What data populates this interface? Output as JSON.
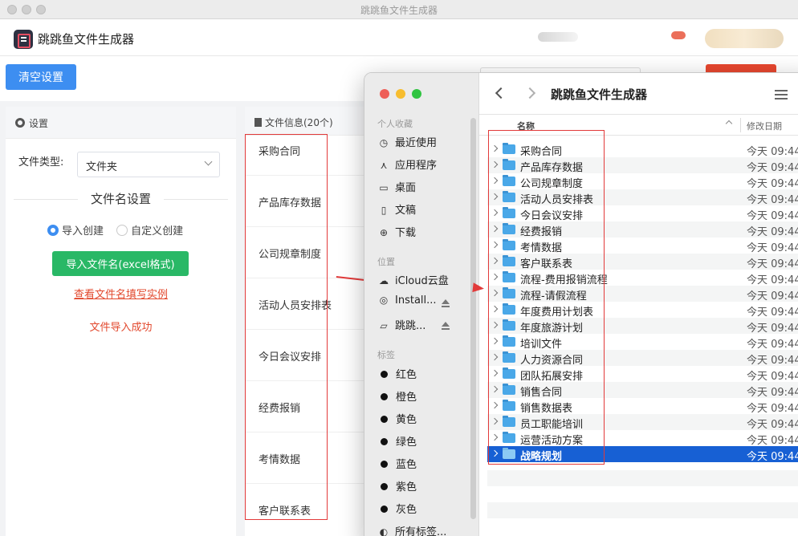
{
  "window": {
    "title": "跳跳鱼文件生成器"
  },
  "header": {
    "app_name": "跳跳鱼文件生成器"
  },
  "toolbar": {
    "clear_label": "清空设置"
  },
  "settings": {
    "title": "设置",
    "file_type_label": "文件类型:",
    "file_type_value": "文件夹",
    "section_title": "文件名设置",
    "radio_import": "导入创建",
    "radio_custom": "自定义创建",
    "import_button": "导入文件名(excel格式)",
    "example_link": "查看文件名填写实例",
    "import_status": "文件导入成功"
  },
  "file_info": {
    "title": "文件信息(20个)",
    "items": [
      "采购合同",
      "产品库存数据",
      "公司规章制度",
      "活动人员安排表",
      "今日会议安排",
      "经费报销",
      "考情数据",
      "客户联系表"
    ]
  },
  "finder": {
    "title": "跳跳鱼文件生成器",
    "sidebar": {
      "favorites_label": "个人收藏",
      "favorites": [
        {
          "label": "最近使用",
          "icon": "clock-icon"
        },
        {
          "label": "应用程序",
          "icon": "apps-icon"
        },
        {
          "label": "桌面",
          "icon": "desktop-icon"
        },
        {
          "label": "文稿",
          "icon": "document-icon"
        },
        {
          "label": "下载",
          "icon": "download-icon"
        }
      ],
      "locations_label": "位置",
      "locations": [
        {
          "label": "iCloud云盘",
          "icon": "cloud-icon"
        },
        {
          "label": "Install...",
          "icon": "disk-icon"
        },
        {
          "label": "跳跳...",
          "icon": "drive-icon"
        }
      ],
      "tags_label": "标签",
      "tags": [
        "红色",
        "橙色",
        "黄色",
        "绿色",
        "蓝色",
        "紫色",
        "灰色"
      ],
      "all_tags": "所有标签..."
    },
    "columns": {
      "name": "名称",
      "date": "修改日期"
    },
    "rows": [
      {
        "name": "采购合同",
        "date": "今天 09:44"
      },
      {
        "name": "产品库存数据",
        "date": "今天 09:44"
      },
      {
        "name": "公司规章制度",
        "date": "今天 09:44"
      },
      {
        "name": "活动人员安排表",
        "date": "今天 09:44"
      },
      {
        "name": "今日会议安排",
        "date": "今天 09:44"
      },
      {
        "name": "经费报销",
        "date": "今天 09:44"
      },
      {
        "name": "考情数据",
        "date": "今天 09:44"
      },
      {
        "name": "客户联系表",
        "date": "今天 09:44"
      },
      {
        "name": "流程-费用报销流程",
        "date": "今天 09:44"
      },
      {
        "name": "流程-请假流程",
        "date": "今天 09:44"
      },
      {
        "name": "年度费用计划表",
        "date": "今天 09:44"
      },
      {
        "name": "年度旅游计划",
        "date": "今天 09:44"
      },
      {
        "name": "培训文件",
        "date": "今天 09:44"
      },
      {
        "name": "人力资源合同",
        "date": "今天 09:44"
      },
      {
        "name": "团队拓展安排",
        "date": "今天 09:44"
      },
      {
        "name": "销售合同",
        "date": "今天 09:44"
      },
      {
        "name": "销售数据表",
        "date": "今天 09:44"
      },
      {
        "name": "员工职能培训",
        "date": "今天 09:44"
      },
      {
        "name": "运营活动方案",
        "date": "今天 09:44"
      },
      {
        "name": "战略规划",
        "date": "今天 09:44"
      }
    ],
    "selected_index": 19
  },
  "colors": {
    "primary": "#3d8ef1",
    "success": "#29b866",
    "danger": "#e2482d",
    "annotation": "#e23a3a",
    "selection": "#1760d4"
  }
}
